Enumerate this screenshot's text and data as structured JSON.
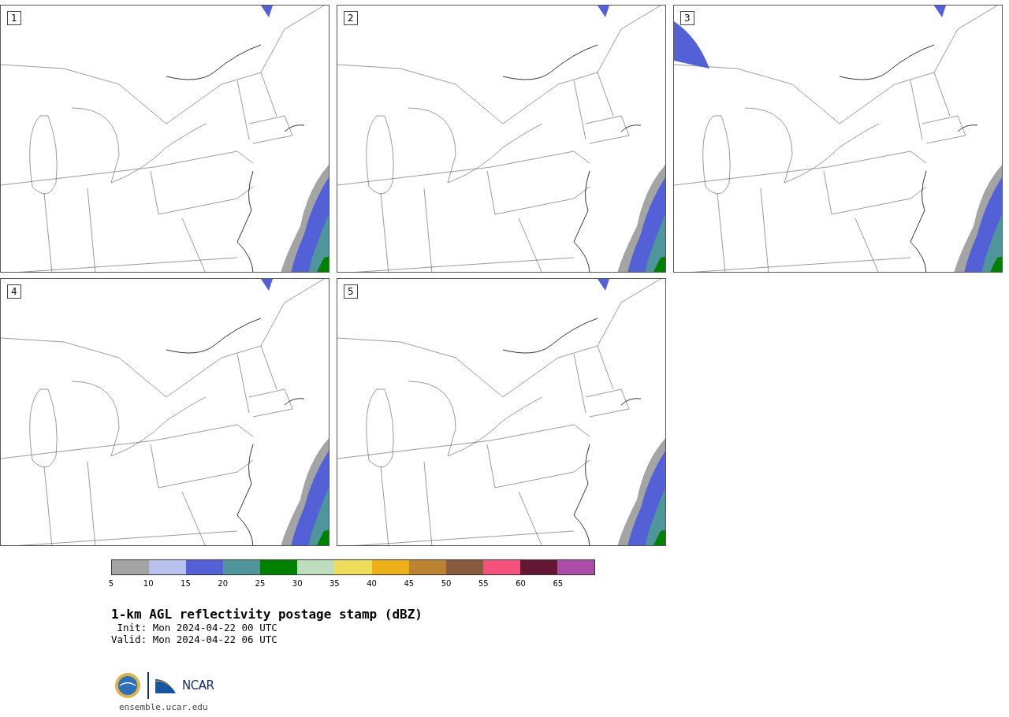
{
  "panels": [
    {
      "label": "1"
    },
    {
      "label": "2"
    },
    {
      "label": "3"
    },
    {
      "label": "4"
    },
    {
      "label": "5"
    }
  ],
  "colorbar": {
    "segments": [
      {
        "color": "#a4a4a4"
      },
      {
        "color": "#b8c2ec"
      },
      {
        "color": "#5360d6"
      },
      {
        "color": "#4f969c"
      },
      {
        "color": "#008000"
      },
      {
        "color": "#bedcbe"
      },
      {
        "color": "#eedc5c"
      },
      {
        "color": "#eeb018"
      },
      {
        "color": "#bc842f"
      },
      {
        "color": "#8a5a3e"
      },
      {
        "color": "#f4517d"
      },
      {
        "color": "#631735"
      },
      {
        "color": "#ac4ca8"
      }
    ],
    "ticks": [
      "5",
      "10",
      "15",
      "20",
      "25",
      "30",
      "35",
      "40",
      "45",
      "50",
      "55",
      "60",
      "65"
    ]
  },
  "title": "1-km AGL reflectivity postage stamp (dBZ)",
  "init": " Init: Mon 2024-04-22 00 UTC",
  "valid": "Valid: Mon 2024-04-22 06 UTC",
  "footer": {
    "logo_text": "NCAR",
    "site": "ensemble.ucar.edu"
  }
}
